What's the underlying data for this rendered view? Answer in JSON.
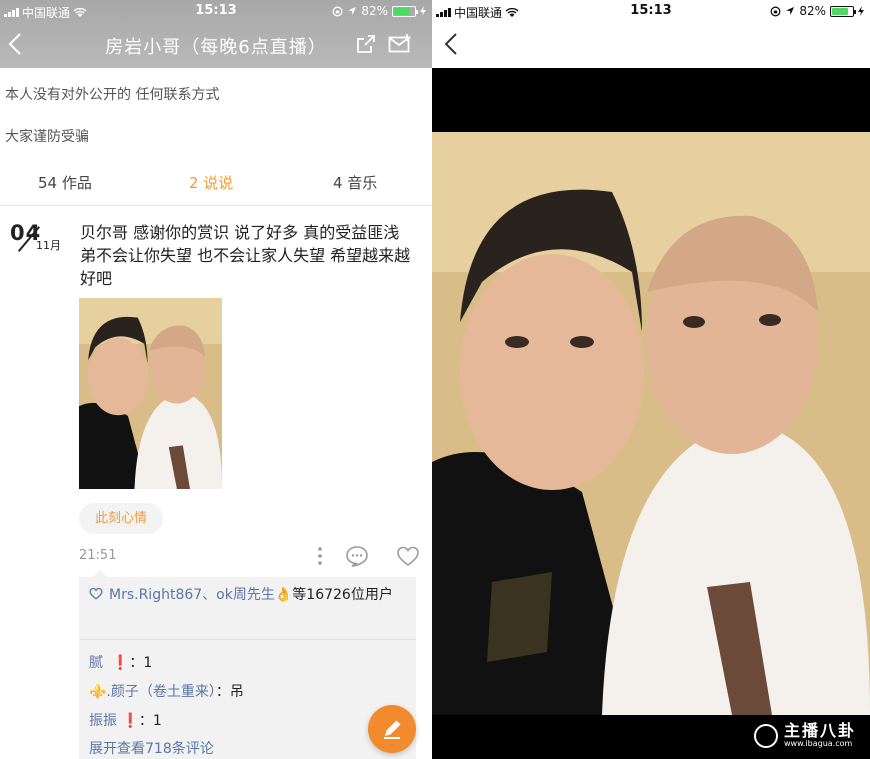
{
  "left": {
    "status": {
      "carrier": "中国联通",
      "time": "15:13",
      "battery": "82%"
    },
    "header": {
      "title": "房岩小哥（每晚6点直播）"
    },
    "bio": [
      "本人没有对外公开的 任何联系方式",
      "大家谨防受骗"
    ],
    "tabs": [
      {
        "label": "54 作品"
      },
      {
        "label": "2 说说"
      },
      {
        "label": "4 音乐"
      }
    ],
    "post": {
      "day": "04",
      "month": "11月",
      "text": "贝尔哥 感谢你的赏识 说了好多 真的受益匪浅 弟不会让你失望 也不会让家人失望 希望越来越好吧",
      "mood": "此刻心情",
      "time": "21:51"
    },
    "likes": {
      "users": "Mrs.Right867、ok周先生👌",
      "suffix": "等16726位用户"
    },
    "comments": [
      {
        "name": "腻",
        "mark": "❗",
        "text": "：1"
      },
      {
        "name": "⚜️.颜子（卷土重来）",
        "mark": "",
        "text": "：吊"
      },
      {
        "name": "振振",
        "mark": "❗",
        "text": "：1"
      }
    ],
    "more": "展开查看718条评论"
  },
  "right": {
    "status": {
      "carrier": "中国联通",
      "time": "15:13",
      "battery": "82%"
    },
    "watermark": {
      "text": "主播八卦",
      "url": "www.ibagua.com"
    }
  },
  "colors": {
    "accent": "#f29b38",
    "link": "#5a76a6"
  },
  "icons": [
    "back-arrow-icon",
    "share-icon",
    "message-icon",
    "more-icon",
    "comment-icon",
    "heart-icon",
    "pencil-icon"
  ]
}
